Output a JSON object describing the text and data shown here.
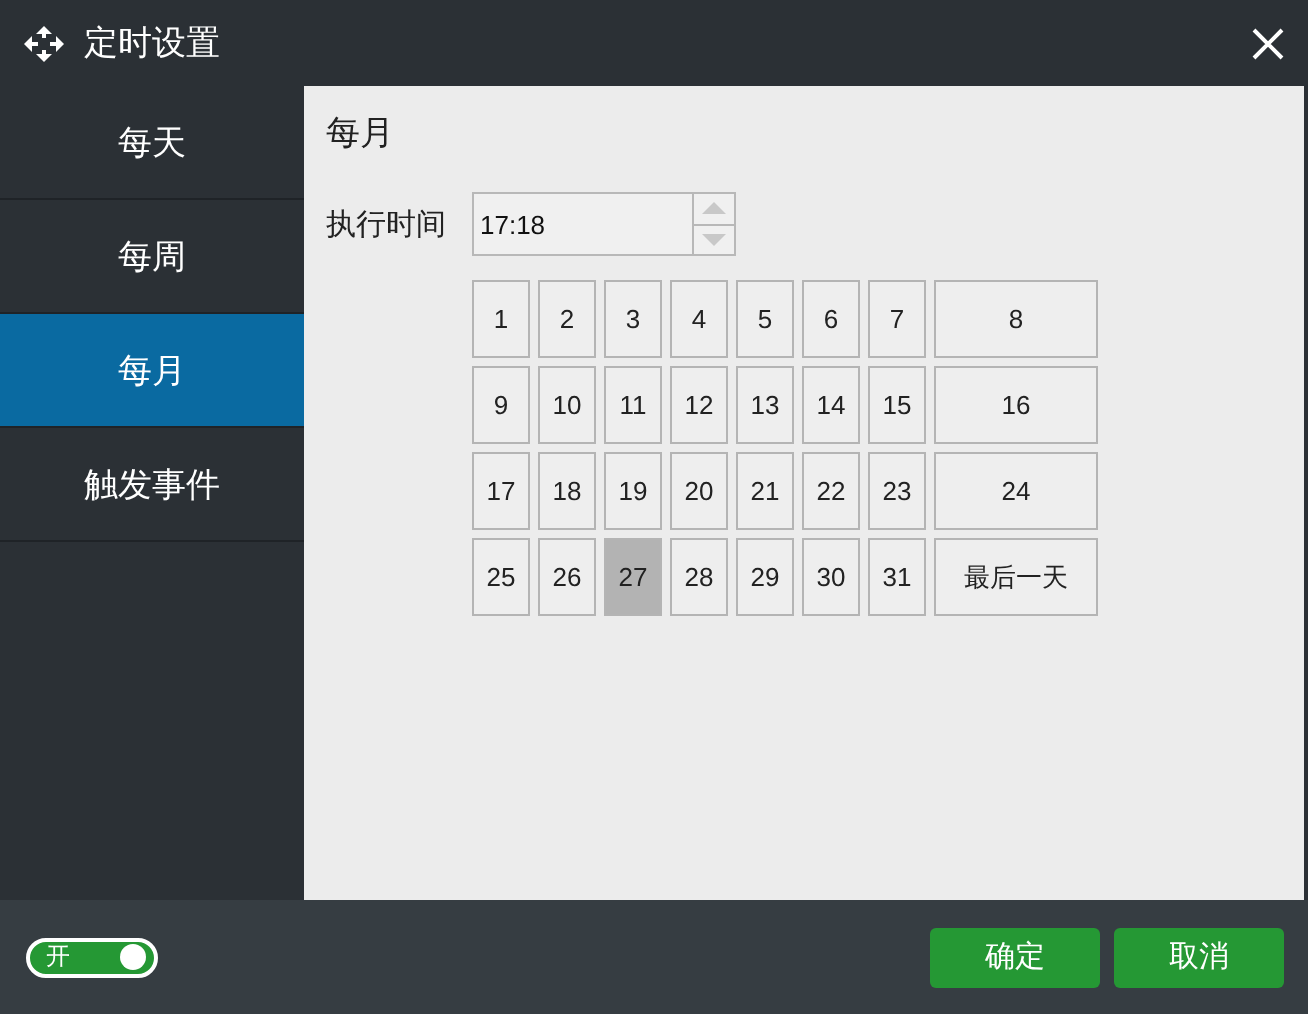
{
  "window": {
    "title": "定时设置"
  },
  "sidebar": {
    "items": [
      {
        "label": "每天",
        "selected": false
      },
      {
        "label": "每周",
        "selected": false
      },
      {
        "label": "每月",
        "selected": true
      },
      {
        "label": "触发事件",
        "selected": false
      }
    ]
  },
  "panel": {
    "heading": "每月",
    "time_label": "执行时间",
    "time_value": "17:18",
    "days": [
      {
        "label": "1",
        "selected": false
      },
      {
        "label": "2",
        "selected": false
      },
      {
        "label": "3",
        "selected": false
      },
      {
        "label": "4",
        "selected": false
      },
      {
        "label": "5",
        "selected": false
      },
      {
        "label": "6",
        "selected": false
      },
      {
        "label": "7",
        "selected": false
      },
      {
        "label": "8",
        "selected": false
      },
      {
        "label": "9",
        "selected": false
      },
      {
        "label": "10",
        "selected": false
      },
      {
        "label": "11",
        "selected": false
      },
      {
        "label": "12",
        "selected": false
      },
      {
        "label": "13",
        "selected": false
      },
      {
        "label": "14",
        "selected": false
      },
      {
        "label": "15",
        "selected": false
      },
      {
        "label": "16",
        "selected": false
      },
      {
        "label": "17",
        "selected": false
      },
      {
        "label": "18",
        "selected": false
      },
      {
        "label": "19",
        "selected": false
      },
      {
        "label": "20",
        "selected": false
      },
      {
        "label": "21",
        "selected": false
      },
      {
        "label": "22",
        "selected": false
      },
      {
        "label": "23",
        "selected": false
      },
      {
        "label": "24",
        "selected": false
      },
      {
        "label": "25",
        "selected": false
      },
      {
        "label": "26",
        "selected": false
      },
      {
        "label": "27",
        "selected": true
      },
      {
        "label": "28",
        "selected": false
      },
      {
        "label": "29",
        "selected": false
      },
      {
        "label": "30",
        "selected": false
      },
      {
        "label": "31",
        "selected": false
      },
      {
        "label": "最后一天",
        "selected": false
      }
    ]
  },
  "footer": {
    "toggle": {
      "label": "开",
      "on": true
    },
    "buttons": [
      "确定",
      "取消"
    ]
  }
}
